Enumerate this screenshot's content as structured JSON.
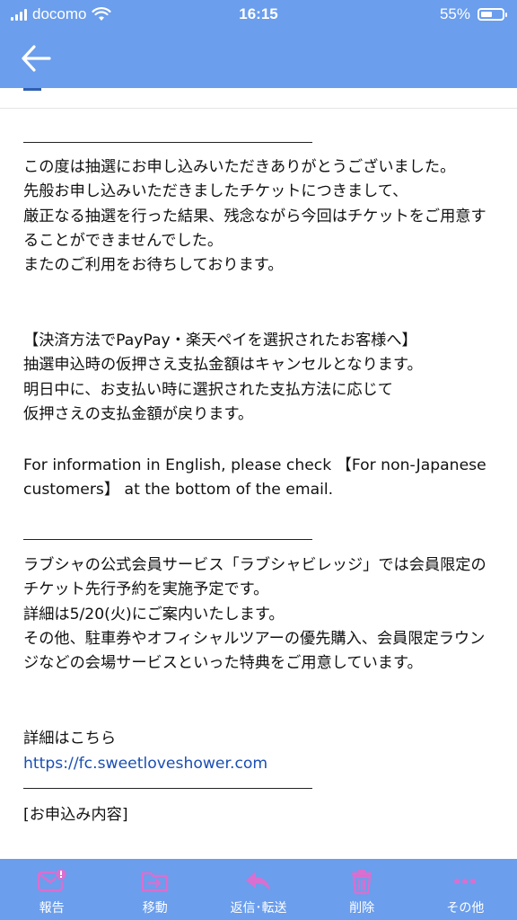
{
  "status_bar": {
    "carrier": "docomo",
    "time": "16:15",
    "battery": "55%",
    "battery_level": 0.55
  },
  "nav": {
    "back_icon": "arrow-left-icon"
  },
  "colors": {
    "bar": "#6b9eec",
    "link": "#1a4fb5"
  },
  "email": {
    "p1": "この度は抽選にお申し込みいただきありがとうございました。\n先般お申し込みいただきましたチケットにつきまして、\n厳正なる抽選を行った結果、残念ながら今回はチケットをご用意することができませんでした。\nまたのご利用をお待ちしております。",
    "p2": "【決済方法でPayPay・楽天ペイを選択されたお客様へ】\n抽選申込時の仮押さえ支払金額はキャンセルとなります。\n明日中に、お支払い時に選択された支払方法に応じて\n仮押さえの支払金額が戻ります。",
    "p3": "For information in English, please check 【For non-Japanese customers】 at the bottom of the email.",
    "p4": "ラブシャの公式会員サービス「ラブシャビレッジ」では会員限定のチケット先行予約を実施予定です。\n詳細は5/20(火)にご案内いたします。\nその他、駐車券やオフィシャルツアーの優先購入、会員限定ラウンジなどの会場サービスといった特典をご用意しています。",
    "details_label": "詳細はこちら",
    "details_link": "https://fc.sweetloveshower.com",
    "application_heading": "[お申込み内容]"
  },
  "toolbar": {
    "items": [
      {
        "label": "報告",
        "icon": "report-mail-icon"
      },
      {
        "label": "移動",
        "icon": "move-folder-icon"
      },
      {
        "label": "返信･転送",
        "icon": "reply-icon"
      },
      {
        "label": "削除",
        "icon": "trash-icon"
      },
      {
        "label": "その他",
        "icon": "more-icon"
      }
    ]
  }
}
